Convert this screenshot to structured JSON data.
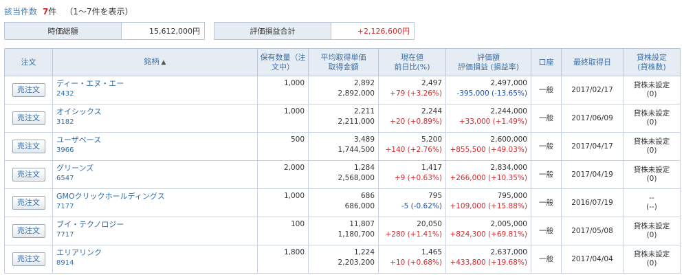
{
  "summary": {
    "count_label": "該当件数",
    "count_value": "7",
    "count_unit": "件",
    "range_text": "（1〜7件を表示）",
    "market_value_label": "時価総額",
    "market_value": "15,612,000円",
    "pl_total_label": "評価損益合計",
    "pl_total": "+2,126,600円"
  },
  "table": {
    "headers": {
      "order": "注文",
      "name": "銘柄",
      "qty": "保有数量（注文中）",
      "avg_l1": "平均取得単価",
      "avg_l2": "取得金額",
      "price_l1": "現在値",
      "price_l2": "前日比(%)",
      "eval_l1": "評価額",
      "eval_l2": "評価損益 (損益率)",
      "account": "口座",
      "date": "最終取得日",
      "lend_l1": "貸株設定",
      "lend_l2": "(貸株数)"
    },
    "sort_arrow": "▲",
    "rows": [
      {
        "order": "売注文",
        "name": "ディー・エヌ・エー",
        "code": "2432",
        "qty": "1,000",
        "avg_price": "2,892",
        "cost": "2,892,000",
        "price": "2,497",
        "change": "+79 (+3.26%)",
        "change_dir": "pos",
        "eval": "2,497,000",
        "pl": "-395,000 (-13.65%)",
        "pl_dir": "neg",
        "account": "一般",
        "date": "2017/02/17",
        "lend": "貸株未設定",
        "lend_qty": "(0)"
      },
      {
        "order": "売注文",
        "name": "オイシックス",
        "code": "3182",
        "qty": "1,000",
        "avg_price": "2,211",
        "cost": "2,211,000",
        "price": "2,244",
        "change": "+20 (+0.89%)",
        "change_dir": "pos",
        "eval": "2,244,000",
        "pl": "+33,000 (+1.49%)",
        "pl_dir": "pos",
        "account": "一般",
        "date": "2017/06/09",
        "lend": "貸株未設定",
        "lend_qty": "(0)"
      },
      {
        "order": "売注文",
        "name": "ユーザベース",
        "code": "3966",
        "qty": "500",
        "avg_price": "3,489",
        "cost": "1,744,500",
        "price": "5,200",
        "change": "+140 (+2.76%)",
        "change_dir": "pos",
        "eval": "2,600,000",
        "pl": "+855,500 (+49.03%)",
        "pl_dir": "pos",
        "account": "一般",
        "date": "2017/04/17",
        "lend": "貸株未設定",
        "lend_qty": "(0)"
      },
      {
        "order": "売注文",
        "name": "グリーンズ",
        "code": "6547",
        "qty": "2,000",
        "avg_price": "1,284",
        "cost": "2,568,000",
        "price": "1,417",
        "change": "+9 (+0.63%)",
        "change_dir": "pos",
        "eval": "2,834,000",
        "pl": "+266,000 (+10.35%)",
        "pl_dir": "pos",
        "account": "一般",
        "date": "2017/04/19",
        "lend": "貸株未設定",
        "lend_qty": "(0)"
      },
      {
        "order": "売注文",
        "name": "GMOクリックホールディングス",
        "code": "7177",
        "qty": "1,000",
        "avg_price": "686",
        "cost": "686,000",
        "price": "795",
        "change": "-5 (-0.62%)",
        "change_dir": "neg",
        "eval": "795,000",
        "pl": "+109,000 (+15.88%)",
        "pl_dir": "pos",
        "account": "一般",
        "date": "2016/07/19",
        "lend": "--",
        "lend_qty": "(--)"
      },
      {
        "order": "売注文",
        "name": "ブイ・テクノロジー",
        "code": "7717",
        "qty": "100",
        "avg_price": "11,807",
        "cost": "1,180,700",
        "price": "20,050",
        "change": "+280 (+1.41%)",
        "change_dir": "pos",
        "eval": "2,005,000",
        "pl": "+824,300 (+69.81%)",
        "pl_dir": "pos",
        "account": "一般",
        "date": "2017/05/08",
        "lend": "貸株未設定",
        "lend_qty": "(0)"
      },
      {
        "order": "売注文",
        "name": "エリアリンク",
        "code": "8914",
        "qty": "1,800",
        "avg_price": "1,224",
        "cost": "2,203,200",
        "price": "1,465",
        "change": "+10 (+0.68%)",
        "change_dir": "pos",
        "eval": "2,637,000",
        "pl": "+433,800 (+19.68%)",
        "pl_dir": "pos",
        "account": "一般",
        "date": "2017/04/04",
        "lend": "貸株未設定",
        "lend_qty": "(0)"
      }
    ]
  }
}
